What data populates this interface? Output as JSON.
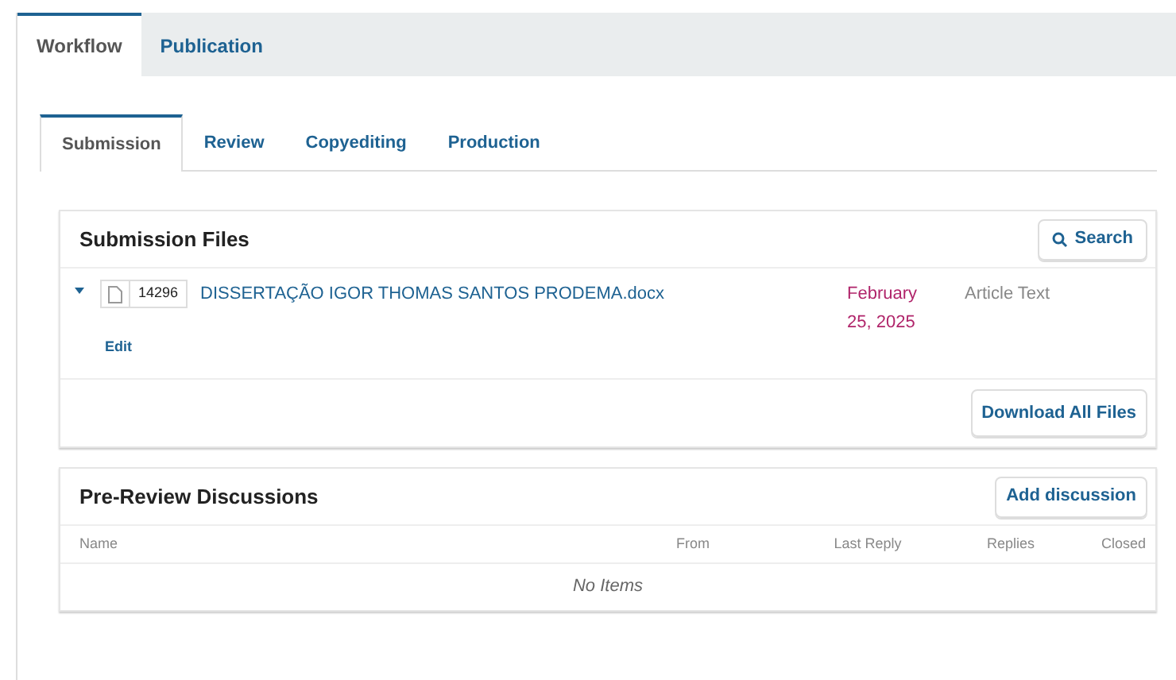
{
  "tabs": [
    {
      "label": "Workflow",
      "selected": true
    },
    {
      "label": "Publication",
      "selected": false
    }
  ],
  "subtabs": [
    {
      "label": "Submission",
      "selected": true
    },
    {
      "label": "Review",
      "selected": false
    },
    {
      "label": "Copyediting",
      "selected": false
    },
    {
      "label": "Production",
      "selected": false
    }
  ],
  "submission_files": {
    "title": "Submission Files",
    "search_button": "Search",
    "files": [
      {
        "expanded": true,
        "id": "14296",
        "name": "DISSERTAÇÃO IGOR THOMAS SANTOS PRODEMA.docx",
        "date": "February 25, 2025",
        "type": "Article Text",
        "edit": "Edit"
      }
    ],
    "download_button": "Download All Files"
  },
  "discussions": {
    "title": "Pre-Review Discussions",
    "add_button": "Add discussion",
    "columns": [
      "Name",
      "From",
      "Last Reply",
      "Replies",
      "Closed"
    ],
    "empty": "No Items"
  }
}
